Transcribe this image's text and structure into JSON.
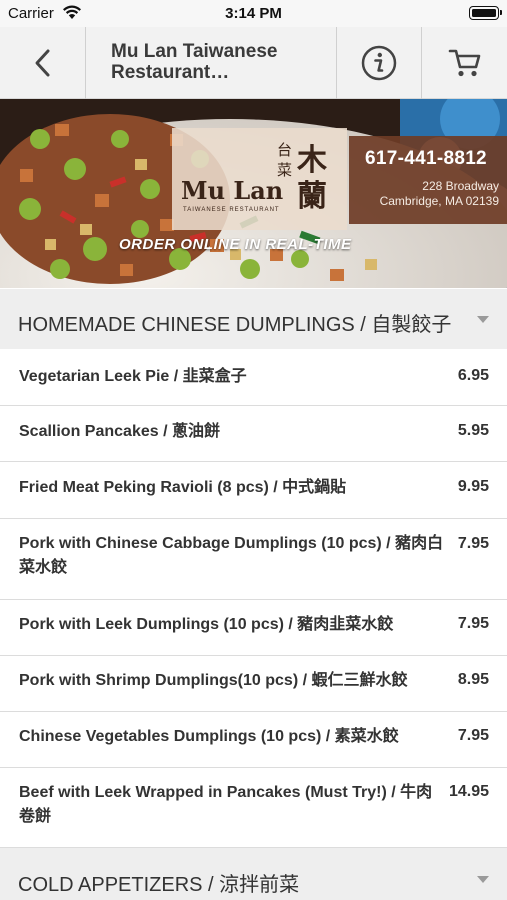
{
  "status_bar": {
    "carrier": "Carrier",
    "time": "3:14 PM"
  },
  "nav": {
    "title": "Mu Lan Taiwanese Restaurant…",
    "back_icon": "chevron-left-icon",
    "info_icon": "info-icon",
    "cart_icon": "cart-icon"
  },
  "banner": {
    "logo_cjk_1": "台",
    "logo_cjk_2": "菜",
    "logo_cjk_3": "木",
    "logo_cjk_4": "蘭",
    "logo_name": "Mu Lan",
    "logo_sub": "TAIWANESE RESTAURANT",
    "phone": "617-441-8812",
    "address_line1": "228 Broadway",
    "address_line2": "Cambridge, MA 02139",
    "order_online": "ORDER ONLINE IN REAL-TIME"
  },
  "sections": [
    {
      "title": "HOMEMADE CHINESE DUMPLINGS / 自製餃子",
      "items": [
        {
          "name": "Vegetarian Leek Pie / 韭菜盒子",
          "price": "6.95"
        },
        {
          "name": "Scallion Pancakes / 蔥油餅",
          "price": "5.95"
        },
        {
          "name": "Fried Meat Peking Ravioli (8 pcs) / 中式鍋貼",
          "price": "9.95"
        },
        {
          "name": "Pork with Chinese Cabbage Dumplings (10 pcs) / 豬肉白菜水餃",
          "price": "7.95"
        },
        {
          "name": "Pork with Leek Dumplings (10 pcs) / 豬肉韭菜水餃",
          "price": "7.95"
        },
        {
          "name": "Pork with Shrimp Dumplings(10 pcs) / 蝦仁三鮮水餃",
          "price": "8.95"
        },
        {
          "name": "Chinese Vegetables Dumplings (10 pcs) / 素菜水餃",
          "price": "7.95"
        },
        {
          "name": "Beef with Leek Wrapped in Pancakes (Must Try!) / 牛肉卷餅",
          "price": "14.95"
        }
      ]
    },
    {
      "title": "COLD APPETIZERS / 涼拌前菜"
    }
  ]
}
